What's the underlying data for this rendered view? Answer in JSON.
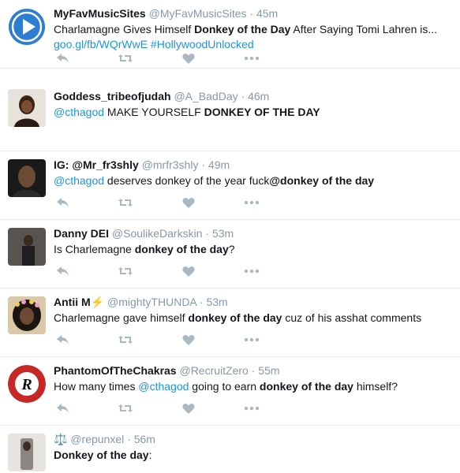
{
  "tweets": [
    {
      "name": "MyFavMusicSites",
      "handle": "@MyFavMusicSites",
      "time": "45m",
      "avatar_icon": "play-button-icon",
      "body_parts": [
        "Charlamagne Gives Himself ",
        "Donkey of the Day",
        " After Saying Tomi Lahren is..."
      ],
      "link1": "goo.gl/fb/WQrWwE",
      "link2": "#HollywoodUnlocked"
    },
    {
      "name": "Goddess_tribeofjudah",
      "handle": "@A_BadDay",
      "time": "46m",
      "mention": "@cthagod",
      "body_parts": [
        " MAKE YOURSELF ",
        "DONKEY OF THE DAY"
      ]
    },
    {
      "name": "IG: @Mr_fr3shly",
      "handle": "@mrfr3shly",
      "time": "49m",
      "mention": "@cthagod",
      "body_parts": [
        " deserves donkey of the year fuck",
        "@donkey of the day"
      ]
    },
    {
      "name": "Danny DEI",
      "handle": "@SoulikeDarkskin",
      "time": "53m",
      "body_parts": [
        "Is Charlemagne ",
        "donkey of the day",
        "?"
      ]
    },
    {
      "name": "Antii M",
      "name_emoji": "⚡",
      "handle": "@mightyTHUNDA",
      "time": "53m",
      "body_parts": [
        "Charlemagne gave himself ",
        "donkey of the day",
        " cuz of his asshat comments"
      ]
    },
    {
      "name": "PhantomOfTheChakras",
      "handle": "@RecruitZero",
      "time": "55m",
      "avatar_letter": "R",
      "body_parts": [
        "How many times ",
        "@cthagod",
        " going to earn ",
        "donkey of the day",
        " himself?"
      ]
    },
    {
      "name_emoji": "⚖️",
      "handle": "@repunxel",
      "time": "56m",
      "body_parts": [
        "Donkey of the day",
        ":"
      ]
    }
  ],
  "dot": "·",
  "colors": {
    "accent": "#1b95e0",
    "muted": "#8899a6",
    "icon": "#aab8c2",
    "play_blue": "#2d7dd2",
    "phantom_red": "#c62828"
  },
  "icons": [
    "reply-icon",
    "retweet-icon",
    "like-heart-icon",
    "more-dots-icon"
  ]
}
